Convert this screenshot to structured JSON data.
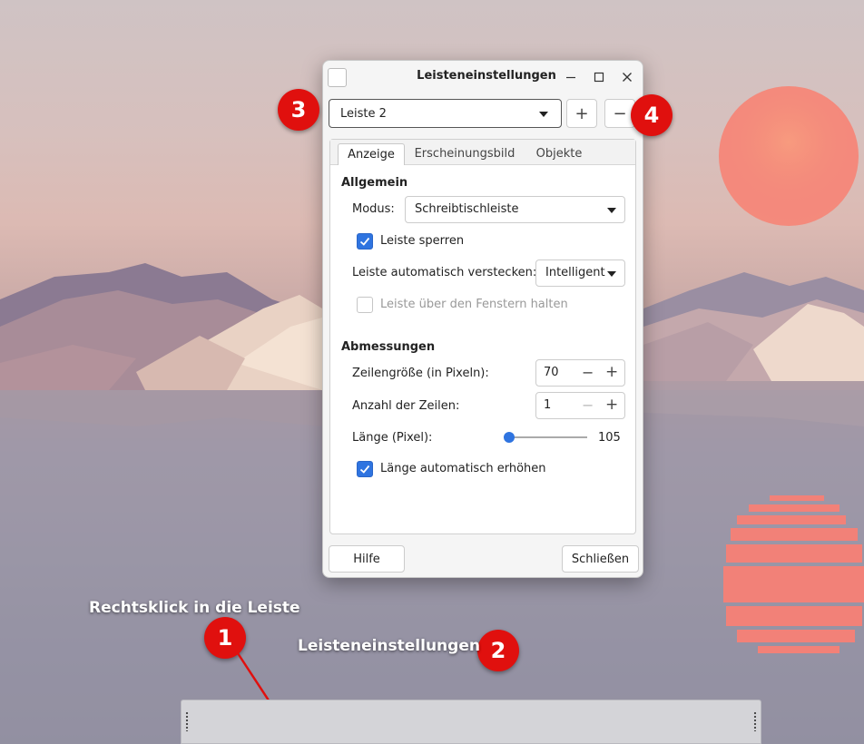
{
  "window": {
    "title": "Leisteneinstellungen",
    "minimize_icon": "minimize-icon",
    "maximize_icon": "maximize-icon",
    "close_icon": "close-icon"
  },
  "panel_selector": {
    "value": "Leiste 2",
    "add_label": "+",
    "remove_label": "−"
  },
  "tabs": [
    {
      "label": "Anzeige",
      "active": true
    },
    {
      "label": "Erscheinungsbild",
      "active": false
    },
    {
      "label": "Objekte",
      "active": false
    }
  ],
  "general": {
    "heading": "Allgemein",
    "mode_label": "Modus:",
    "mode_value": "Schreibtischleiste",
    "lock_label": "Leiste sperren",
    "lock_checked": true,
    "autohide_label": "Leiste automatisch verstecken:",
    "autohide_value": "Intelligent",
    "keep_above_label": "Leiste über den Fenstern halten",
    "keep_above_checked": false,
    "keep_above_enabled": false
  },
  "dimensions": {
    "heading": "Abmessungen",
    "row_size_label": "Zeilengröße (in Pixeln):",
    "row_size_value": "70",
    "rows_label": "Anzahl der Zeilen:",
    "rows_value": "1",
    "length_label": "Länge (Pixel):",
    "length_value": "105",
    "autoincrease_label": "Länge automatisch erhöhen",
    "autoincrease_checked": true,
    "minus": "−",
    "plus": "+"
  },
  "footer": {
    "help_label": "Hilfe",
    "close_label": "Schließen"
  },
  "annotations": {
    "right_click": "Rechtsklick in die Leiste",
    "menu_item": "Leisteneinstellungen",
    "badges": [
      "1",
      "2",
      "3",
      "4"
    ]
  },
  "colors": {
    "accent": "#2f74e0",
    "badge_red": "#e0100e"
  }
}
